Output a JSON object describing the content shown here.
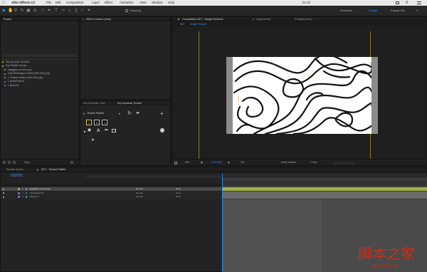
{
  "menubar": {
    "app_name": "After Effects CC",
    "items": [
      "File",
      "Edit",
      "Composition",
      "Layer",
      "Effect",
      "Animation",
      "View",
      "Window",
      "Help"
    ],
    "clock": "01:10"
  },
  "toolbar": {
    "snapping_label": "Snapping",
    "workspaces": [
      "Essentials",
      "Regular",
      "Regular Win"
    ]
  },
  "project_panel": {
    "title": "Project",
    "items": [
      "Key Dynamic Textures",
      "Key Palette Groups",
      "squiggles_texture.png",
      "Dots Reddingen-DOMO-(000-000).png",
      "C Texture-Hotline-(000-000).png",
      "L BrushPaint.tif",
      "L Brush.tif"
    ],
    "footer_label": "8 bpc"
  },
  "effect_controls": {
    "tab_label": "Effect Controls (none)"
  },
  "composition_viewer": {
    "tabs": [
      "Composition NCT - Bangin Textured",
      "Layer (none)",
      "Footage (none)"
    ],
    "subtabs": [
      "NCT",
      "Bangin Textured"
    ],
    "bottom_bar": [
      "50%",
      "0:00:00:00",
      "Full",
      "Active Camera",
      "1 View"
    ]
  },
  "key_panel": {
    "tabs": [
      "Key Dynamic Color",
      "Key Dynamic Texture"
    ],
    "dropdown_label": "Texture Palette",
    "key_labels": [
      "J",
      "K",
      "L"
    ],
    "type_label": "A"
  },
  "timeline": {
    "tabs": [
      "Render Queue",
      "NCT - Texture Palette"
    ],
    "timecode": "000000",
    "layers": [
      {
        "num": "1",
        "name": "squiggles_texture.png",
        "mode": "Normal",
        "parent": "None",
        "selected": true
      },
      {
        "num": "2",
        "name": "L BrushPaint.tif",
        "mode": "Normal",
        "parent": "None",
        "selected": false
      },
      {
        "num": "3",
        "name": "L Brush.tif",
        "mode": "Normal",
        "parent": "None",
        "selected": false
      }
    ]
  },
  "watermark": {
    "cn": "脚本之家",
    "url": "www.jb51.net"
  },
  "colors": {
    "accent_blue": "#2d8ceb",
    "timecode_blue": "#3f8fe8",
    "highlight_yellow": "#e0c55a",
    "layer_bar_green": "#9fb04a",
    "layer_bar_gray": "#6a6a6a",
    "watermark_red": "#c8301c"
  }
}
